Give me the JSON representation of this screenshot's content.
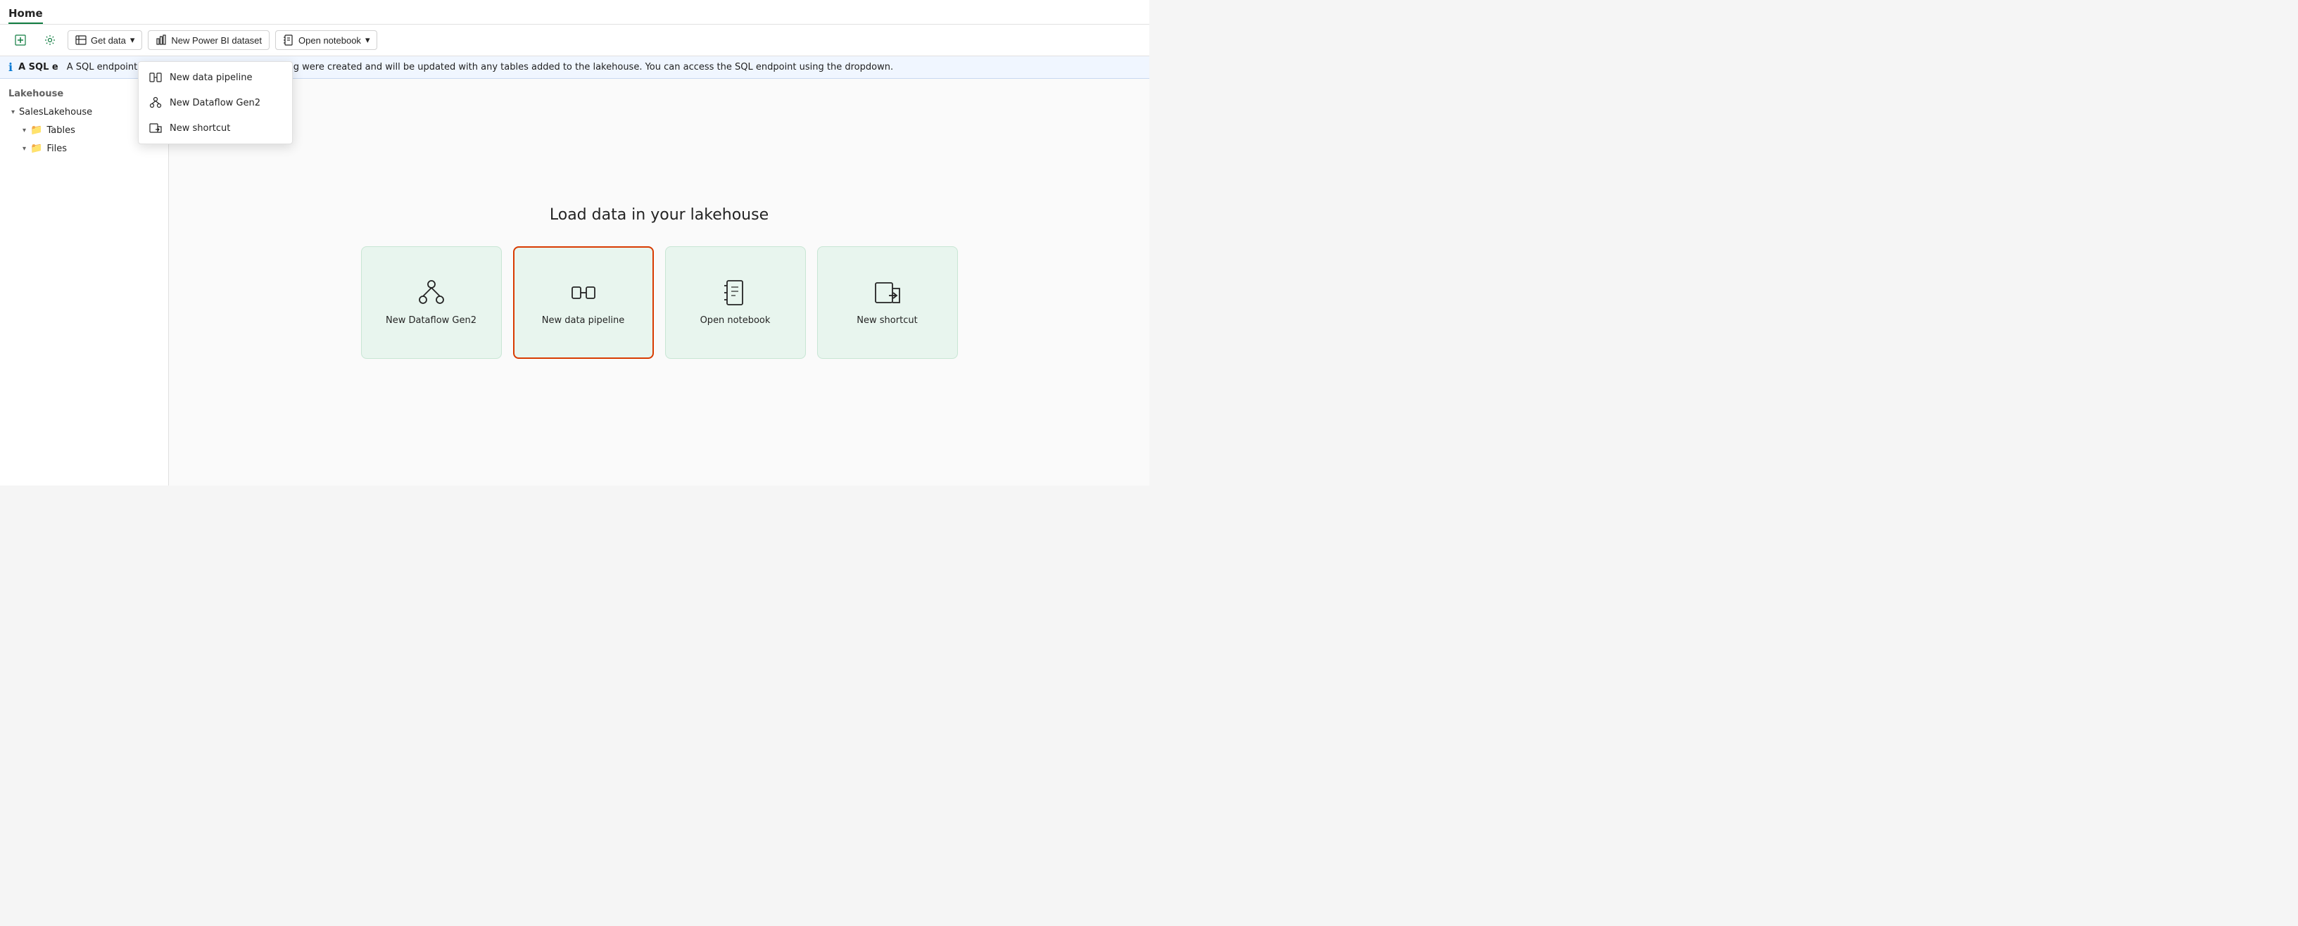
{
  "page": {
    "title": "Home"
  },
  "toolbar": {
    "get_data_label": "Get data",
    "new_power_bi_label": "New Power BI dataset",
    "open_notebook_label": "Open notebook"
  },
  "notification": {
    "text": "A SQL endpoint and a default dataset for reporting were created and will be updated with any tables added to the lakehouse. You can access the SQL endpoint using the dropdown."
  },
  "sidebar": {
    "lakehouse_label": "Lakehouse",
    "sales_lakehouse": "SalesLakehouse",
    "tables": "Tables",
    "files": "Files"
  },
  "main": {
    "heading": "Load data in your lakehouse",
    "cards": [
      {
        "id": "dataflow",
        "label": "New Dataflow Gen2",
        "icon": "dataflow"
      },
      {
        "id": "pipeline",
        "label": "New data pipeline",
        "icon": "pipeline",
        "highlighted": true
      },
      {
        "id": "notebook",
        "label": "Open notebook",
        "icon": "notebook"
      },
      {
        "id": "shortcut",
        "label": "New shortcut",
        "icon": "shortcut"
      }
    ]
  },
  "dropdown": {
    "items": [
      {
        "id": "pipeline",
        "label": "New data pipeline",
        "icon": "pipeline"
      },
      {
        "id": "dataflow",
        "label": "New Dataflow Gen2",
        "icon": "dataflow"
      },
      {
        "id": "shortcut",
        "label": "New shortcut",
        "icon": "shortcut"
      }
    ]
  },
  "colors": {
    "accent": "#107c41",
    "highlight_border": "#d83b01",
    "card_bg": "#e8f5ee"
  }
}
